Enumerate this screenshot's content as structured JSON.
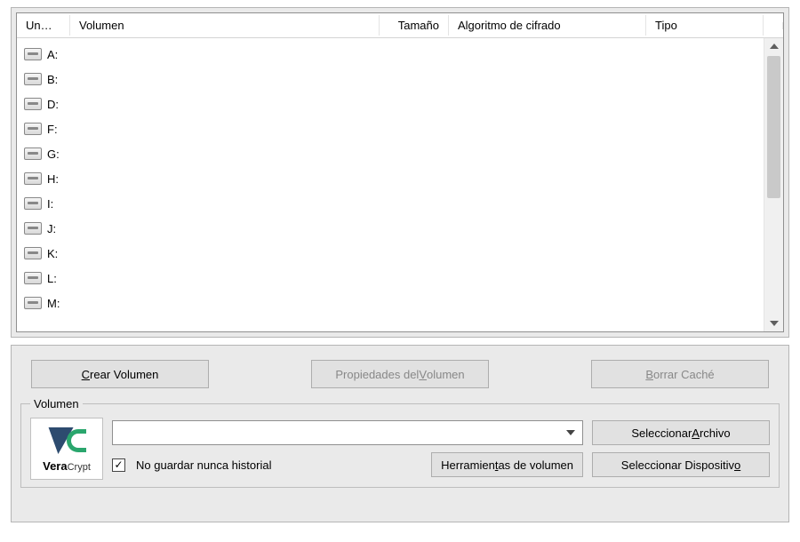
{
  "columns": {
    "drive": "Un…",
    "volume": "Volumen",
    "size": "Tamaño",
    "algorithm": "Algoritmo de cifrado",
    "type": "Tipo"
  },
  "drives": [
    "A:",
    "B:",
    "D:",
    "F:",
    "G:",
    "H:",
    "I:",
    "J:",
    "K:",
    "L:",
    "M:"
  ],
  "buttons": {
    "create_pre": "",
    "create_ul": "C",
    "create_post": "rear Volumen",
    "props_pre": "Propiedades del ",
    "props_ul": "V",
    "props_post": "olumen",
    "wipe_pre": "",
    "wipe_ul": "B",
    "wipe_post": "orrar Caché"
  },
  "group_label": "Volumen",
  "logo_name": "VeraCrypt",
  "combo_value": "",
  "select_file_pre": "Seleccionar ",
  "select_file_ul": "A",
  "select_file_post": "rchivo",
  "checkbox_label": "No guardar nunca historial",
  "checkbox_checked": true,
  "tools_pre": "Herramien",
  "tools_ul": "t",
  "tools_post": "as de volumen",
  "select_dev_pre": "Seleccionar Dispositiv",
  "select_dev_ul": "o",
  "select_dev_post": ""
}
